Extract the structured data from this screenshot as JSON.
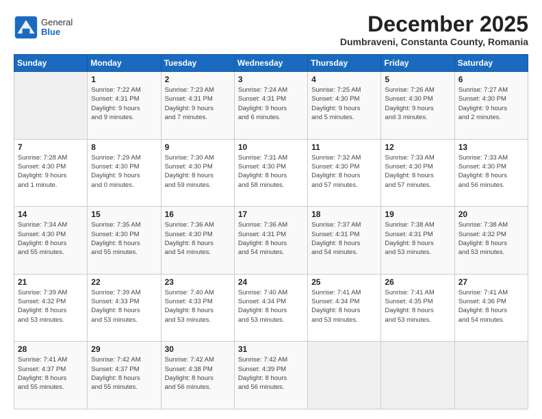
{
  "logo": {
    "general": "General",
    "blue": "Blue"
  },
  "header": {
    "month": "December 2025",
    "location": "Dumbraveni, Constanta County, Romania"
  },
  "weekdays": [
    "Sunday",
    "Monday",
    "Tuesday",
    "Wednesday",
    "Thursday",
    "Friday",
    "Saturday"
  ],
  "weeks": [
    [
      {
        "day": "",
        "info": ""
      },
      {
        "day": "1",
        "info": "Sunrise: 7:22 AM\nSunset: 4:31 PM\nDaylight: 9 hours\nand 9 minutes."
      },
      {
        "day": "2",
        "info": "Sunrise: 7:23 AM\nSunset: 4:31 PM\nDaylight: 9 hours\nand 7 minutes."
      },
      {
        "day": "3",
        "info": "Sunrise: 7:24 AM\nSunset: 4:31 PM\nDaylight: 9 hours\nand 6 minutes."
      },
      {
        "day": "4",
        "info": "Sunrise: 7:25 AM\nSunset: 4:30 PM\nDaylight: 9 hours\nand 5 minutes."
      },
      {
        "day": "5",
        "info": "Sunrise: 7:26 AM\nSunset: 4:30 PM\nDaylight: 9 hours\nand 3 minutes."
      },
      {
        "day": "6",
        "info": "Sunrise: 7:27 AM\nSunset: 4:30 PM\nDaylight: 9 hours\nand 2 minutes."
      }
    ],
    [
      {
        "day": "7",
        "info": "Sunrise: 7:28 AM\nSunset: 4:30 PM\nDaylight: 9 hours\nand 1 minute."
      },
      {
        "day": "8",
        "info": "Sunrise: 7:29 AM\nSunset: 4:30 PM\nDaylight: 9 hours\nand 0 minutes."
      },
      {
        "day": "9",
        "info": "Sunrise: 7:30 AM\nSunset: 4:30 PM\nDaylight: 8 hours\nand 59 minutes."
      },
      {
        "day": "10",
        "info": "Sunrise: 7:31 AM\nSunset: 4:30 PM\nDaylight: 8 hours\nand 58 minutes."
      },
      {
        "day": "11",
        "info": "Sunrise: 7:32 AM\nSunset: 4:30 PM\nDaylight: 8 hours\nand 57 minutes."
      },
      {
        "day": "12",
        "info": "Sunrise: 7:33 AM\nSunset: 4:30 PM\nDaylight: 8 hours\nand 57 minutes."
      },
      {
        "day": "13",
        "info": "Sunrise: 7:33 AM\nSunset: 4:30 PM\nDaylight: 8 hours\nand 56 minutes."
      }
    ],
    [
      {
        "day": "14",
        "info": "Sunrise: 7:34 AM\nSunset: 4:30 PM\nDaylight: 8 hours\nand 55 minutes."
      },
      {
        "day": "15",
        "info": "Sunrise: 7:35 AM\nSunset: 4:30 PM\nDaylight: 8 hours\nand 55 minutes."
      },
      {
        "day": "16",
        "info": "Sunrise: 7:36 AM\nSunset: 4:30 PM\nDaylight: 8 hours\nand 54 minutes."
      },
      {
        "day": "17",
        "info": "Sunrise: 7:36 AM\nSunset: 4:31 PM\nDaylight: 8 hours\nand 54 minutes."
      },
      {
        "day": "18",
        "info": "Sunrise: 7:37 AM\nSunset: 4:31 PM\nDaylight: 8 hours\nand 54 minutes."
      },
      {
        "day": "19",
        "info": "Sunrise: 7:38 AM\nSunset: 4:31 PM\nDaylight: 8 hours\nand 53 minutes."
      },
      {
        "day": "20",
        "info": "Sunrise: 7:38 AM\nSunset: 4:32 PM\nDaylight: 8 hours\nand 53 minutes."
      }
    ],
    [
      {
        "day": "21",
        "info": "Sunrise: 7:39 AM\nSunset: 4:32 PM\nDaylight: 8 hours\nand 53 minutes."
      },
      {
        "day": "22",
        "info": "Sunrise: 7:39 AM\nSunset: 4:33 PM\nDaylight: 8 hours\nand 53 minutes."
      },
      {
        "day": "23",
        "info": "Sunrise: 7:40 AM\nSunset: 4:33 PM\nDaylight: 8 hours\nand 53 minutes."
      },
      {
        "day": "24",
        "info": "Sunrise: 7:40 AM\nSunset: 4:34 PM\nDaylight: 8 hours\nand 53 minutes."
      },
      {
        "day": "25",
        "info": "Sunrise: 7:41 AM\nSunset: 4:34 PM\nDaylight: 8 hours\nand 53 minutes."
      },
      {
        "day": "26",
        "info": "Sunrise: 7:41 AM\nSunset: 4:35 PM\nDaylight: 8 hours\nand 53 minutes."
      },
      {
        "day": "27",
        "info": "Sunrise: 7:41 AM\nSunset: 4:36 PM\nDaylight: 8 hours\nand 54 minutes."
      }
    ],
    [
      {
        "day": "28",
        "info": "Sunrise: 7:41 AM\nSunset: 4:37 PM\nDaylight: 8 hours\nand 55 minutes."
      },
      {
        "day": "29",
        "info": "Sunrise: 7:42 AM\nSunset: 4:37 PM\nDaylight: 8 hours\nand 55 minutes."
      },
      {
        "day": "30",
        "info": "Sunrise: 7:42 AM\nSunset: 4:38 PM\nDaylight: 8 hours\nand 56 minutes."
      },
      {
        "day": "31",
        "info": "Sunrise: 7:42 AM\nSunset: 4:39 PM\nDaylight: 8 hours\nand 56 minutes."
      },
      {
        "day": "",
        "info": ""
      },
      {
        "day": "",
        "info": ""
      },
      {
        "day": "",
        "info": ""
      }
    ]
  ]
}
